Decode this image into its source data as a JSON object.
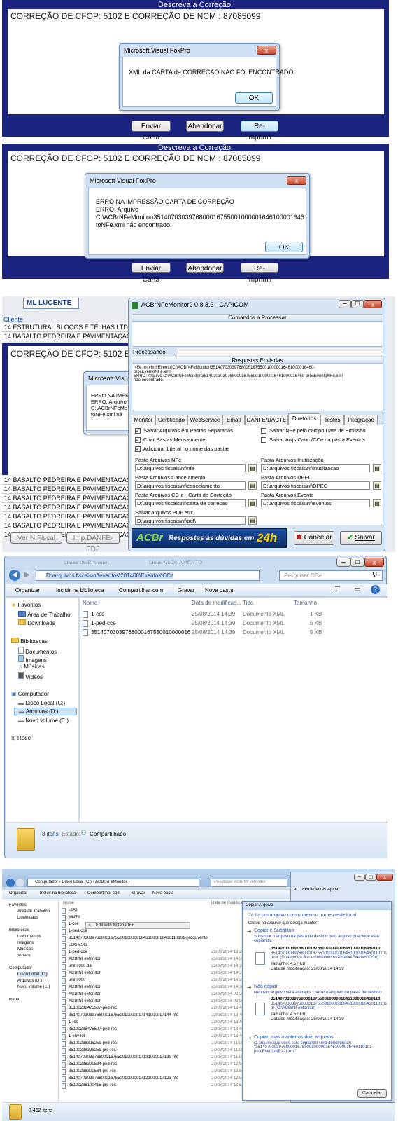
{
  "panel1": {
    "header": "Descreva a Correção:",
    "text": "CORREÇÃO DE CFOP:  5102 E CORREÇÃO DE NCM : 87085099",
    "dialog_title": "Microsoft Visual FoxPro",
    "dialog_message": "XML da CARTA de CORREÇÃO NÃO FOI ENCONTRADO",
    "ok_label": "OK",
    "close_glyph": "x",
    "buttons": [
      "Enviar Carta",
      "Abandonar",
      "Re-Imprimir"
    ]
  },
  "panel2": {
    "header": "Descreva a Correção:",
    "text": "CORREÇÃO DE CFOP:  5102 E CORREÇÃO DE NCM : 87085099",
    "dialog_title": "Microsoft Visual FoxPro",
    "dialog_lines": [
      "ERRO NA IMPRESSÃO CARTA DE CORREÇÃO",
      "ERRO: Arquivo",
      "C:\\ACBrNFeMonitor\\35140703039768000167550010000016461000016460-procEven",
      "toNFe.xml não encontrado."
    ],
    "ok_label": "OK",
    "close_glyph": "x",
    "buttons": [
      "Enviar Carta",
      "Abandonar",
      "Re-Imprimir"
    ]
  },
  "panel3": {
    "client_name": "ML LUCENTE",
    "client_header": "Cliente",
    "rows_top": [
      "14 ESTRUTURAL BLOCOS E TELHAS LTDA",
      "14 BASALTO PEDREIRA E PAVIMENTAÇÃO L"
    ],
    "rows_bottom": [
      "14 BASALTO PEDREIRA E PAVIMENTACAO L",
      "14 BASALTO PEDREIRA E PAVIMENTACAO L",
      "14 BASALTO PEDREIRA E PAVIMENTACAO L",
      "14 BASALTO PEDREIRA E PAVIMENTACAO L",
      "14 BASALTO PEDREIRA E PAVIMENTACAO L",
      "14 BASALTO PEDREIRA E PAVIMENTACAO L",
      "14 BASALTO PEDREIRA E PAVIMENTACAO L"
    ],
    "bg_text": "CORREÇÃO DE CFOP:  5102 E CORREÇ",
    "bg_dialog_title": "Microsoft Visual",
    "bg_dialog_lines": [
      "ERRO NA IMPR",
      "ERRO: Arquivo",
      "C:\\ACBrNFeMo",
      "toNFe.xml nã"
    ],
    "footer_buttons": [
      "Ver N.Fiscal",
      "Imp.DANFE-PDF"
    ],
    "monitor": {
      "title": "ACBrNFeMonitor2 0.8.8.3 - CAPICOM",
      "commands_header": "Comandos a Processar",
      "processing_label": "Processando:",
      "responses_header": "Respostas Enviadas",
      "responses_lines": [
        "NFe.ImprimirEvento(C:\\ACBrNFeMonitor\\35140703039768000167550010000016461000016460-",
        "procEventoNFe.xml)",
        "ERRO: Arquivo C:\\ACBrNFeMonitor\\35140703039768000167550010000016461000016460-procEventoNFe.xml",
        "não encontrado."
      ],
      "tabs": [
        "Monitor",
        "Certificado",
        "WebService",
        "Email",
        "DANFE/DACTE",
        "Diretórios",
        "Testes",
        "Integração"
      ],
      "checks_left": [
        {
          "label": "Salvar Arquivos em Pastas Separadas",
          "checked": true
        },
        {
          "label": "Criar Pastas Mensalmente",
          "checked": true
        },
        {
          "label": "Adicionar Literal no nome das pastas",
          "checked": true
        }
      ],
      "checks_right": [
        {
          "label": "Salvar NFe pelo campo Data de Emissão",
          "checked": false
        },
        {
          "label": "Salvar Arqs Canc./CCe na pasta Eventos",
          "checked": false
        }
      ],
      "fields_left": [
        {
          "label": "Pasta Arquivos NFe",
          "value": "D:\\arquivos fiscais\\nf\\nfe"
        },
        {
          "label": "Pasta Arquivos Cancelamento",
          "value": "D:\\arquivos fiscais\\nf\\cancelamento"
        },
        {
          "label": "Pasta Arquivos CC-e - Carta de Correção",
          "value": "D:\\arquivos fiscais\\nf\\carta de correcao"
        },
        {
          "label": "Salvar arquivos PDF em:",
          "value": "D:\\arquivos fiscais\\nf\\pdf\\"
        }
      ],
      "fields_right": [
        {
          "label": "Pasta Arquivos Inutilização",
          "value": "D:\\arquivos fiscais\\nf\\inutilizacao"
        },
        {
          "label": "Pasta Arquivos DPEC",
          "value": "D:\\arquivos fiscais\\nf\\DPEC"
        },
        {
          "label": "Pasta Arquivos Evento",
          "value": "D:\\arquivos fiscais\\nf\\eventos"
        }
      ],
      "banner_logo": "ACBr",
      "banner_text": "Respostas às dúvidas em",
      "banner_24h": "24h",
      "cancel_label": "Cancelar",
      "save_label": "Salvar"
    }
  },
  "panel4": {
    "bg_tabs": [
      "Listas de Entrada",
      "Lista: ALONAMENTO"
    ],
    "address": "D:\\arquivos fiscais\\nf\\eventos\\201408\\Eventos\\CCe",
    "search_placeholder": "Pesquisar CCe",
    "toolbar": [
      "Organizar",
      "Incluir na biblioteca",
      "Compartilhar com",
      "Gravar",
      "Nova pasta"
    ],
    "columns": [
      "Nome",
      "Data de modificaç...",
      "Tipo",
      "Tamanho"
    ],
    "files": [
      {
        "name": "1-cce",
        "date": "25/08/2014 14:39",
        "type": "Documento XML",
        "size": "1 KB"
      },
      {
        "name": "1-ped-cce",
        "date": "25/08/2014 14:39",
        "type": "Documento XML",
        "size": "5 KB"
      },
      {
        "name": "351407030397680001675500100000164610...",
        "date": "25/08/2014 14:39",
        "type": "Documento XML",
        "size": "5 KB"
      }
    ],
    "sidebar": {
      "favorites": "Favoritos",
      "fav_items": [
        "Área de Trabalho",
        "Downloads"
      ],
      "libraries": "Bibliotecas",
      "lib_items": [
        "Documentos",
        "Imagens",
        "Músicas",
        "Vídeos"
      ],
      "computer": "Computador",
      "comp_items": [
        "Disco Local (C:)",
        "Arquivos (D:)",
        "Novo volume (E:)"
      ],
      "network": "Rede"
    },
    "status_count": "3 itens",
    "status_state_label": "Estado:",
    "status_state": "Compartilhado"
  },
  "panel5": {
    "address": "Computador › Disco Local (C:) › ACBrNFeMonitor ›",
    "search_placeholder": "Pesquisar ACBrNFeMonitor",
    "toolbar": [
      "Organizar",
      "Incluir na biblioteca",
      "Compartilhar com",
      "Gravar",
      "Nova pasta"
    ],
    "bg_menu": [
      "ar",
      "Ferramentas",
      "Ajuda"
    ],
    "columns": [
      "Nome",
      "Data de modificaç..."
    ],
    "sidebar": {
      "fav": "Favoritos",
      "fav_items": [
        "Área de Trabalho",
        "Downloads"
      ],
      "lib": "Bibliotecas",
      "lib_items": [
        "Documentos",
        "Imagens",
        "Músicas",
        "Vídeos"
      ],
      "comp": "Computador",
      "comp_items": [
        "Disco Local (C:)",
        "Arquivos (D:)",
        "Novo volume (E:)"
      ],
      "net": "Rede"
    },
    "context_menu": "Edit with Notepad++",
    "files": [
      {
        "name": "LOG",
        "date": ""
      },
      {
        "name": "sainfe",
        "date": ""
      },
      {
        "name": "1-cce",
        "date": ""
      },
      {
        "name": "1-ped-cce",
        "date": ""
      },
      {
        "name": "35140703039768000167550010000016461000016460110101-procEventoNFe",
        "date": ""
      },
      {
        "name": "LOGMSG",
        "date": ""
      },
      {
        "name": "1-ped-cce",
        "date": "25/08/2014 13:24"
      },
      {
        "name": "ACBrNFeMonitor",
        "date": "25/08/2014 14:07"
      },
      {
        "name": "unins000.dat",
        "date": "25/08/2014 14:35"
      },
      {
        "name": "ACBrNFeMonitor",
        "date": "25/08/2014 14:31"
      },
      {
        "name": "unins000",
        "date": "25/08/2014 14:35"
      },
      {
        "name": "ACBrNFeMonitor",
        "date": "25/08/2014 14:38"
      },
      {
        "name": "ACBrNFeMonitor",
        "date": "25/08/2014 08:55"
      },
      {
        "name": "ACBrNFeMonitor",
        "date": "25/08/2014 08:55"
      },
      {
        "name": "35100238475507-ped-rec",
        "date": "22/08/2014 13:46"
      },
      {
        "name": "35140703039768000167550010000017141000017144-nfe",
        "date": "22/08/2014 13:46"
      },
      {
        "name": "1-rec",
        "date": "22/08/2014 13:46"
      },
      {
        "name": "35100238475507-ped-rec",
        "date": "22/08/2014 13:46"
      },
      {
        "name": "1-env-lot",
        "date": "22/08/2014 13:46"
      },
      {
        "name": "35100238325259-ped-rec",
        "date": "21/08/2014 11:03"
      },
      {
        "name": "35100238325259-pro-rec",
        "date": "21/08/2014 11:03"
      },
      {
        "name": "35140703039768000167550010000017131000017139-nfe",
        "date": "21/08/2014 11:03"
      },
      {
        "name": "35100238300584-ped-rec",
        "date": "21/08/2014 12:54"
      },
      {
        "name": "35100238300584-pro-rec",
        "date": "21/08/2014 12:54"
      },
      {
        "name": "35140703039768000167550010000017121000017123-nfe",
        "date": "21/08/2014 12:54"
      },
      {
        "name": "35100238100415-pro-rec",
        "date": "21/08/2014 12:52"
      }
    ],
    "status_count": "3.462 itens",
    "copy_dialog": {
      "title": "Copiar Arquivo",
      "heading": "Já há um arquivo com o mesmo nome neste local.",
      "prompt": "Clique no arquivo que deseja manter",
      "opt1_title": "Copiar e Substituir",
      "opt1_desc": "Substituir o arquivo na pasta de destino pelo arquivo que você está copiando:",
      "opt1_file": "35140703039768000167550010000016461000016460110",
      "opt1_path": "35140703039768000167550010000016461000016460110101-proc (D:\\arquivos fiscais\\nf\\eventos\\201408\\Eventos\\CCe)",
      "opt1_size": "Tamanho: 4,57 KB",
      "opt1_date": "Data de modificação: 25/08/2014 14:39",
      "opt2_title": "Não copiar",
      "opt2_desc": "Nenhum arquivo será alterado. Deixar o arquivo na pasta de destino:",
      "opt2_file": "35140703039768000167550010000016461000016460110",
      "opt2_path": "35140703039768000167550010000016461000016460110101-pr (C:\\ACBrNFeMonitor)",
      "opt2_size": "Tamanho: 4,57 KB",
      "opt2_date": "Data de modificação: 25/08/2014 14:39",
      "opt3_title": "Copiar, mas manter os dois arquivos",
      "opt3_desc": "O arquivo que você está copiando será denominado \"35140703039768000167550010000016461000016460110101-procEventoNF (2).xml\"",
      "cancel_label": "Cancelar"
    }
  }
}
